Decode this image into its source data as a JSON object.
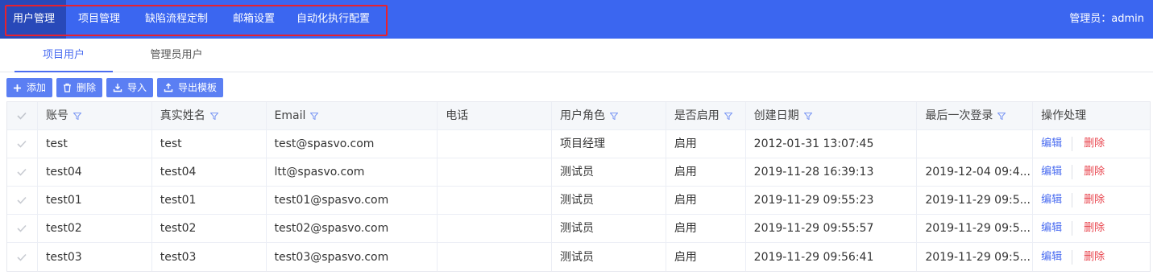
{
  "nav": {
    "items": [
      "用户管理",
      "项目管理",
      "缺陷流程定制",
      "邮箱设置",
      "自动化执行配置"
    ],
    "active_index": 0,
    "admin_label": "管理员：admin"
  },
  "tabs": [
    "项目用户",
    "管理员用户"
  ],
  "toolbar": {
    "add_label": "添加",
    "delete_label": "删除",
    "import_label": "导入",
    "export_label": "导出模板"
  },
  "table": {
    "columns": [
      "账号",
      "真实姓名",
      "Email",
      "电话",
      "用户角色",
      "是否启用",
      "创建日期",
      "最后一次登录",
      "操作处理"
    ],
    "rows": [
      {
        "account": "test",
        "name": "test",
        "email": "test@spasvo.com",
        "phone": "",
        "role": "项目经理",
        "enabled": "启用",
        "created": "2012-01-31 13:07:45",
        "last_login": ""
      },
      {
        "account": "test04",
        "name": "test04",
        "email": "ltt@spasvo.com",
        "phone": "",
        "role": "测试员",
        "enabled": "启用",
        "created": "2019-11-28 16:39:13",
        "last_login": "2019-12-04 09:4..."
      },
      {
        "account": "test01",
        "name": "test01",
        "email": "test01@spasvo.com",
        "phone": "",
        "role": "测试员",
        "enabled": "启用",
        "created": "2019-11-29 09:55:23",
        "last_login": "2019-11-29 09:5..."
      },
      {
        "account": "test02",
        "name": "test02",
        "email": "test02@spasvo.com",
        "phone": "",
        "role": "测试员",
        "enabled": "启用",
        "created": "2019-11-29 09:55:57",
        "last_login": "2019-11-29 09:5..."
      },
      {
        "account": "test03",
        "name": "test03",
        "email": "test03@spasvo.com",
        "phone": "",
        "role": "测试员",
        "enabled": "启用",
        "created": "2019-11-29 09:56:41",
        "last_login": "2019-11-29 09:5..."
      }
    ],
    "edit_label": "编辑",
    "delete_label": "删除"
  },
  "colors": {
    "topbar": "#3b66f0",
    "active_nav": "#2849b9",
    "accent": "#4a6cf0",
    "danger": "#e8434c",
    "highlight_box": "#e8212e"
  },
  "icons": {
    "add": "plus-icon",
    "delete": "trash-icon",
    "import": "download-icon",
    "export": "upload-icon",
    "filter": "filter-icon",
    "check": "check-icon"
  }
}
